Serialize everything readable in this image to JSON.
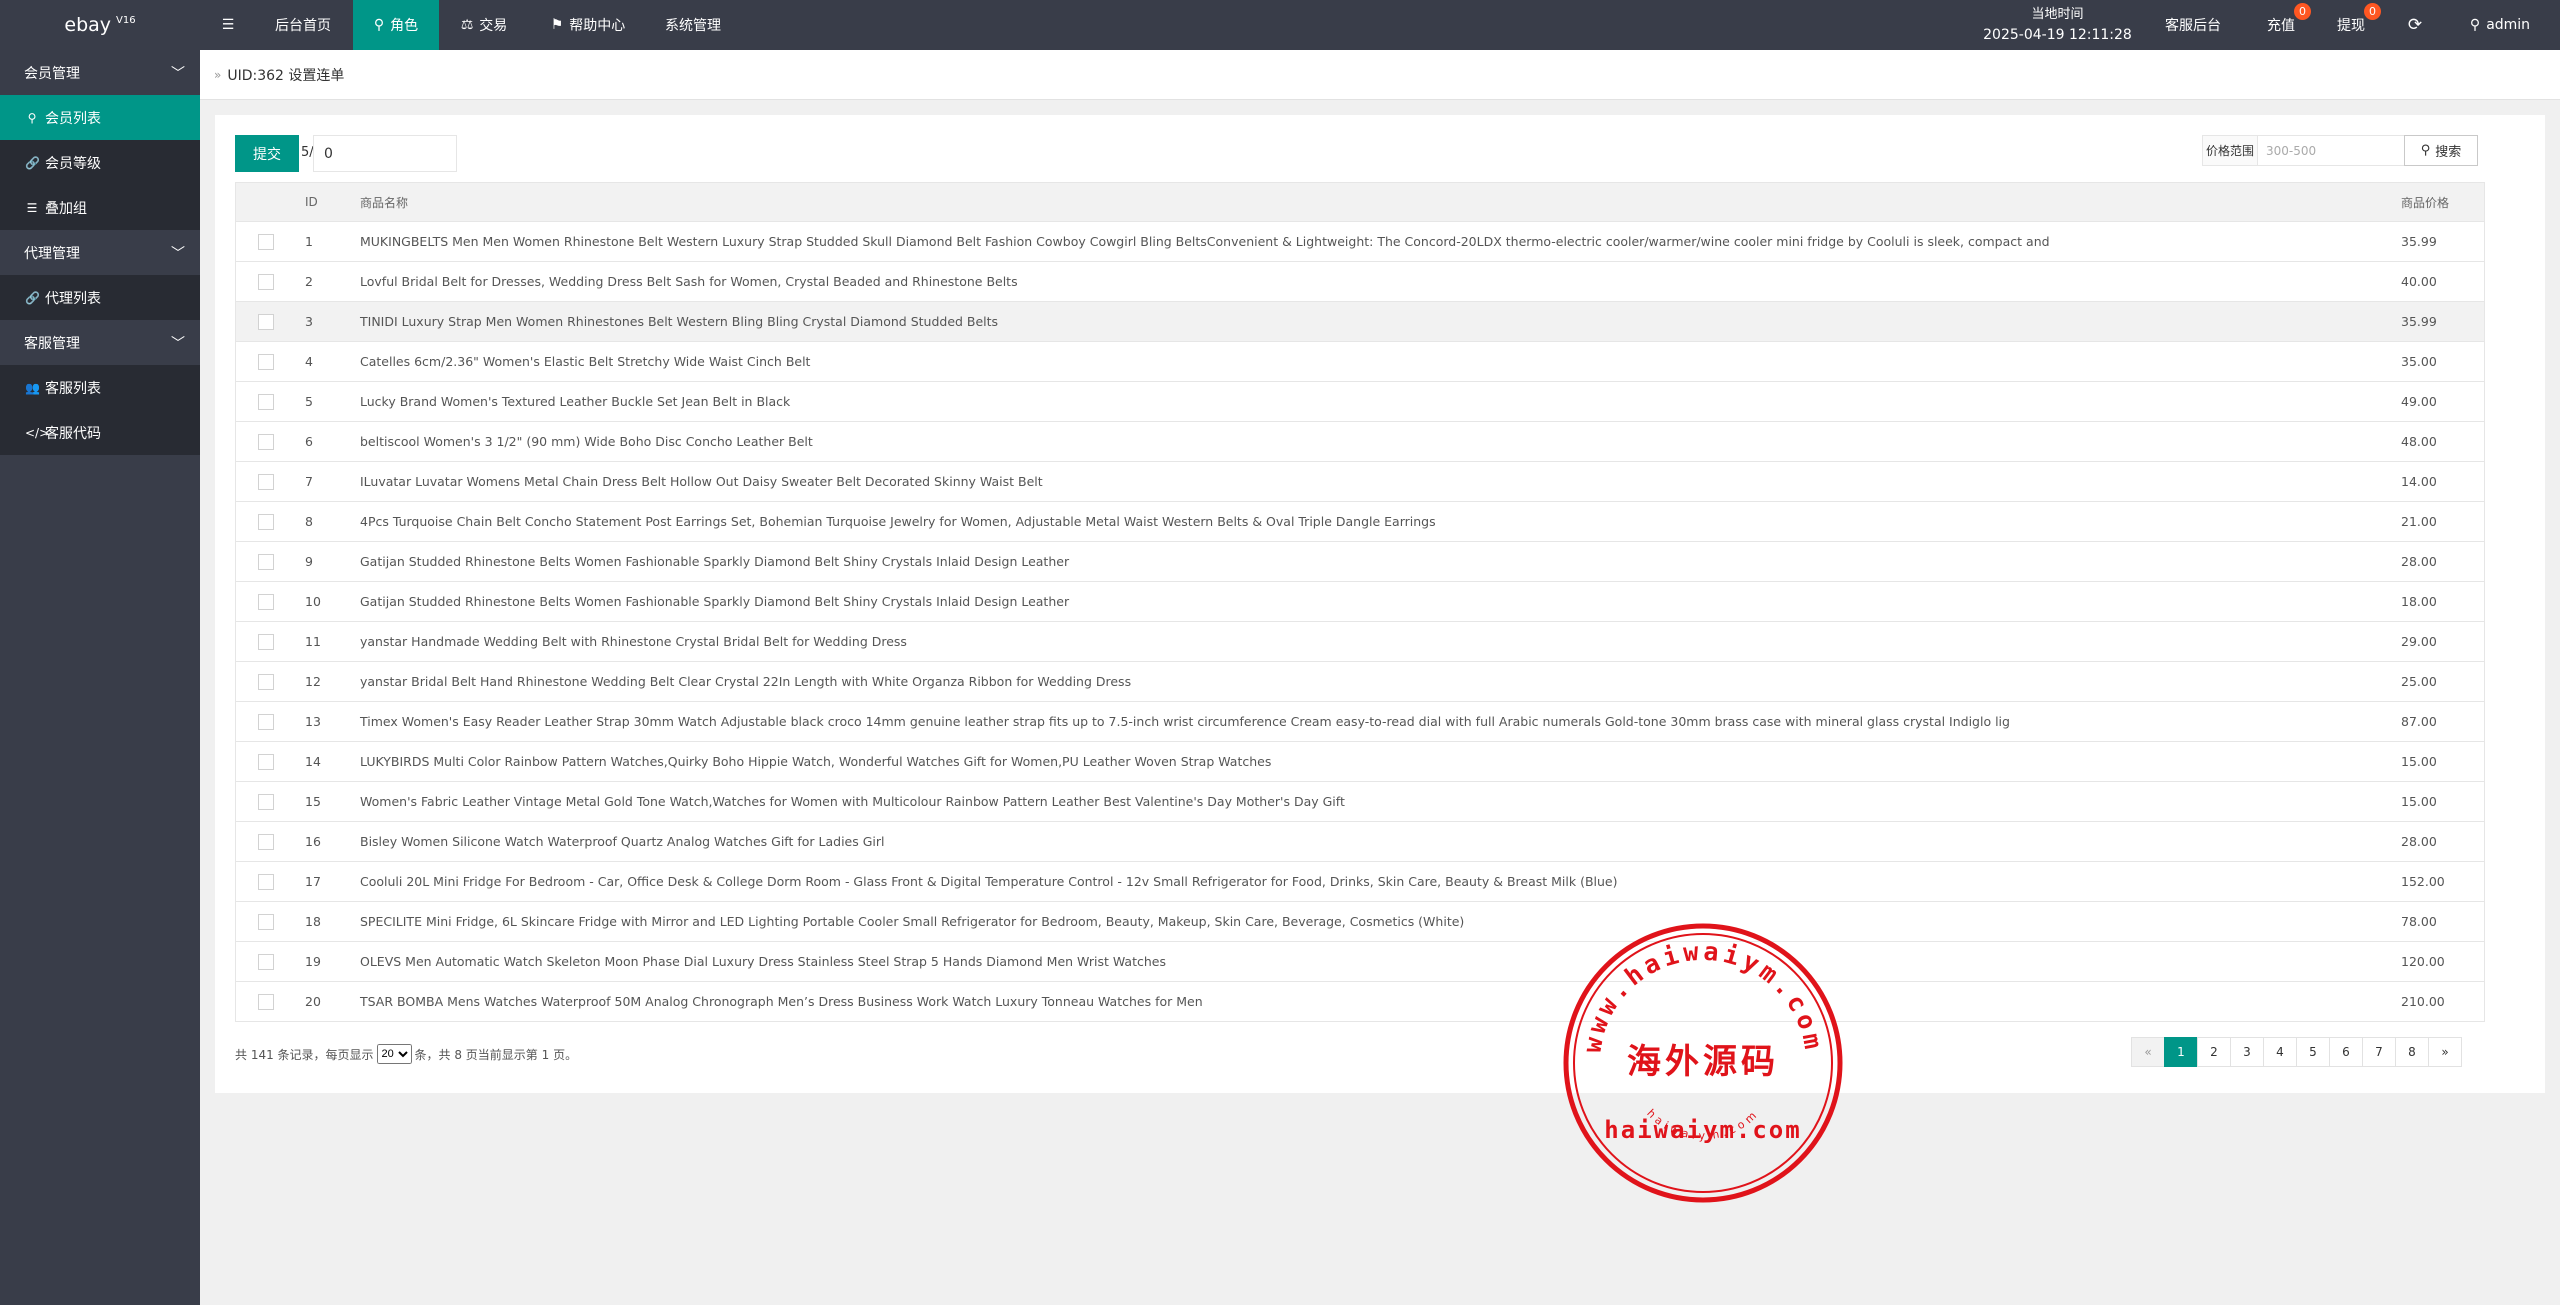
{
  "app": {
    "logo": "ebay",
    "version": "V16"
  },
  "topnav": {
    "menu_icon": "menu-icon",
    "items": [
      {
        "label": "后台首页"
      },
      {
        "label": "角色",
        "icon": "user-icon"
      },
      {
        "label": "交易",
        "icon": "scale-icon"
      },
      {
        "label": "帮助中心",
        "icon": "flag-icon"
      },
      {
        "label": "系统管理"
      }
    ],
    "time_label": "当地时间",
    "time_value": "2025-04-19 12:11:28",
    "service_admin": "客服后台",
    "recharge": "充值",
    "recharge_badge": "0",
    "withdraw": "提现",
    "withdraw_badge": "0",
    "refresh_icon": "refresh-icon",
    "user": "admin"
  },
  "sidebar": {
    "groups": [
      {
        "label": "会员管理",
        "items": [
          {
            "label": "会员列表",
            "icon": "user-icon",
            "active": true
          },
          {
            "label": "会员等级",
            "icon": "link-icon"
          },
          {
            "label": "叠加组",
            "icon": "list-icon"
          }
        ]
      },
      {
        "label": "代理管理",
        "items": [
          {
            "label": "代理列表",
            "icon": "link-icon"
          }
        ]
      },
      {
        "label": "客服管理",
        "items": [
          {
            "label": "客服列表",
            "icon": "users-icon"
          },
          {
            "label": "客服代码",
            "icon": "code-icon"
          }
        ]
      }
    ]
  },
  "breadcrumb": {
    "separator": "»",
    "title": "UID:362 设置连单"
  },
  "toolbar": {
    "submit_label": "提交",
    "slash_prefix": "5/",
    "batch_value": "0",
    "price_label": "价格范围",
    "price_placeholder": "300-500",
    "search_label": "搜索"
  },
  "table": {
    "headers": {
      "id": "ID",
      "name": "商品名称",
      "price": "商品价格"
    },
    "rows": [
      {
        "id": "1",
        "name": "MUKINGBELTS Men Men Women Rhinestone Belt Western Luxury Strap Studded Skull Diamond Belt Fashion Cowboy Cowgirl Bling BeltsConvenient & Lightweight: The Concord-20LDX thermo-electric cooler/warmer/wine cooler mini fridge by Cooluli is sleek, compact and",
        "price": "35.99"
      },
      {
        "id": "2",
        "name": "Lovful Bridal Belt for Dresses, Wedding Dress Belt Sash for Women, Crystal Beaded and Rhinestone Belts",
        "price": "40.00"
      },
      {
        "id": "3",
        "name": "TINIDI Luxury Strap Men Women Rhinestones Belt Western Bling Bling Crystal Diamond Studded Belts",
        "price": "35.99"
      },
      {
        "id": "4",
        "name": "Catelles 6cm/2.36\" Women's Elastic Belt Stretchy Wide Waist Cinch Belt",
        "price": "35.00"
      },
      {
        "id": "5",
        "name": "Lucky Brand Women's Textured Leather Buckle Set Jean Belt in Black",
        "price": "49.00"
      },
      {
        "id": "6",
        "name": "beltiscool Women's 3 1/2\" (90 mm) Wide Boho Disc Concho Leather Belt",
        "price": "48.00"
      },
      {
        "id": "7",
        "name": "ILuvatar Luvatar Womens Metal Chain Dress Belt Hollow Out Daisy Sweater Belt Decorated Skinny Waist Belt",
        "price": "14.00"
      },
      {
        "id": "8",
        "name": "4Pcs Turquoise Chain Belt Concho Statement Post Earrings Set, Bohemian Turquoise Jewelry for Women, Adjustable Metal Waist Western Belts & Oval Triple Dangle Earrings",
        "price": "21.00"
      },
      {
        "id": "9",
        "name": "Gatijan Studded Rhinestone Belts Women Fashionable Sparkly Diamond Belt Shiny Crystals Inlaid Design Leather",
        "price": "28.00"
      },
      {
        "id": "10",
        "name": "Gatijan Studded Rhinestone Belts Women Fashionable Sparkly Diamond Belt Shiny Crystals Inlaid Design Leather",
        "price": "18.00"
      },
      {
        "id": "11",
        "name": "yanstar Handmade Wedding Belt with Rhinestone Crystal Bridal Belt for Wedding Dress",
        "price": "29.00"
      },
      {
        "id": "12",
        "name": "yanstar Bridal Belt Hand Rhinestone Wedding Belt Clear Crystal 22In Length with White Organza Ribbon for Wedding Dress",
        "price": "25.00"
      },
      {
        "id": "13",
        "name": "Timex Women's Easy Reader Leather Strap 30mm Watch Adjustable black croco 14mm genuine leather strap fits up to 7.5-inch wrist circumference Cream easy-to-read dial with full Arabic numerals Gold-tone 30mm brass case with mineral glass crystal Indiglo lig",
        "price": "87.00"
      },
      {
        "id": "14",
        "name": "LUKYBIRDS Multi Color Rainbow Pattern Watches,Quirky Boho Hippie Watch, Wonderful Watches Gift for Women,PU Leather Woven Strap Watches",
        "price": "15.00"
      },
      {
        "id": "15",
        "name": "Women's Fabric Leather Vintage Metal Gold Tone Watch,Watches for Women with Multicolour Rainbow Pattern Leather Best Valentine's Day Mother's Day Gift",
        "price": "15.00"
      },
      {
        "id": "16",
        "name": "Bisley Women Silicone Watch Waterproof Quartz Analog Watches Gift for Ladies Girl",
        "price": "28.00"
      },
      {
        "id": "17",
        "name": "Cooluli 20L Mini Fridge For Bedroom - Car, Office Desk & College Dorm Room - Glass Front & Digital Temperature Control - 12v Small Refrigerator for Food, Drinks, Skin Care, Beauty & Breast Milk (Blue)",
        "price": "152.00"
      },
      {
        "id": "18",
        "name": "SPECILITE Mini Fridge, 6L Skincare Fridge with Mirror and LED Lighting Portable Cooler Small Refrigerator for Bedroom, Beauty, Makeup, Skin Care, Beverage, Cosmetics (White)",
        "price": "78.00"
      },
      {
        "id": "19",
        "name": "OLEVS Men Automatic Watch Skeleton Moon Phase Dial Luxury Dress Stainless Steel Strap 5 Hands Diamond Men Wrist Watches",
        "price": "120.00"
      },
      {
        "id": "20",
        "name": "TSAR BOMBA Mens Watches Waterproof 50M Analog Chronograph Men’s Dress Business Work Watch Luxury Tonneau Watches for Men",
        "price": "210.00"
      }
    ]
  },
  "footer": {
    "prefix": "共 141 条记录，每页显示",
    "page_size": "20",
    "suffix": "条，共 8 页当前显示第 1 页。"
  },
  "pager": {
    "prev": "«",
    "pages": [
      "1",
      "2",
      "3",
      "4",
      "5",
      "6",
      "7",
      "8"
    ],
    "current": "1",
    "next": "»"
  },
  "watermark": {
    "top_text": "www.haiwaiym.com",
    "center_text": "海外源码",
    "domain_text": "haiwaiym.com",
    "bottom_text": "haiwaiym.com"
  },
  "colors": {
    "accent": "#009688",
    "topbar": "#393D49",
    "sidebar_sub": "#282B33",
    "badge": "#FF5722",
    "stamp": "#E0131A"
  }
}
